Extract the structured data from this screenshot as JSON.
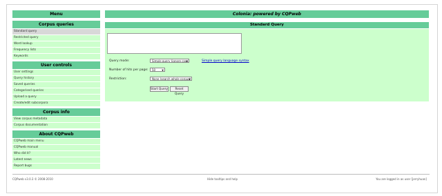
{
  "menu": {
    "title": "Menu",
    "sections": [
      {
        "title": "Corpus queries",
        "items": [
          "Standard query",
          "Restricted query",
          "Word lookup",
          "Frequency lists",
          "Keywords"
        ]
      },
      {
        "title": "User controls",
        "items": [
          "User settings",
          "Query history",
          "Saved queries",
          "Categorised queries",
          "Upload a query",
          "Create/edit subcorpora"
        ]
      },
      {
        "title": "Corpus info",
        "items": [
          "View corpus metadata",
          "Corpus documentation"
        ]
      },
      {
        "title": "About CQPweb",
        "items": [
          "CQPweb main menu",
          "CQPweb manual",
          "Who did it?",
          "Latest news",
          "Report bugs"
        ]
      }
    ]
  },
  "main": {
    "title": "Colonia: powered by CQPweb",
    "panel_title": "Standard Query",
    "query_mode_label": "Query mode:",
    "query_mode_value": "Simple query (ignore case)",
    "syntax_link": "Simple query language syntax",
    "hits_label": "Number of hits per page:",
    "hits_value": "50",
    "restriction_label": "Restriction:",
    "restriction_value": "None (search whole corpus)",
    "start_button": "Start Query",
    "reset_button": "Reset Query"
  },
  "footer": {
    "left": "CQPweb v3.0.3 © 2008-2010",
    "center": "Hide tooltips and help",
    "right": "You are logged in as user [jerryhuan]"
  }
}
